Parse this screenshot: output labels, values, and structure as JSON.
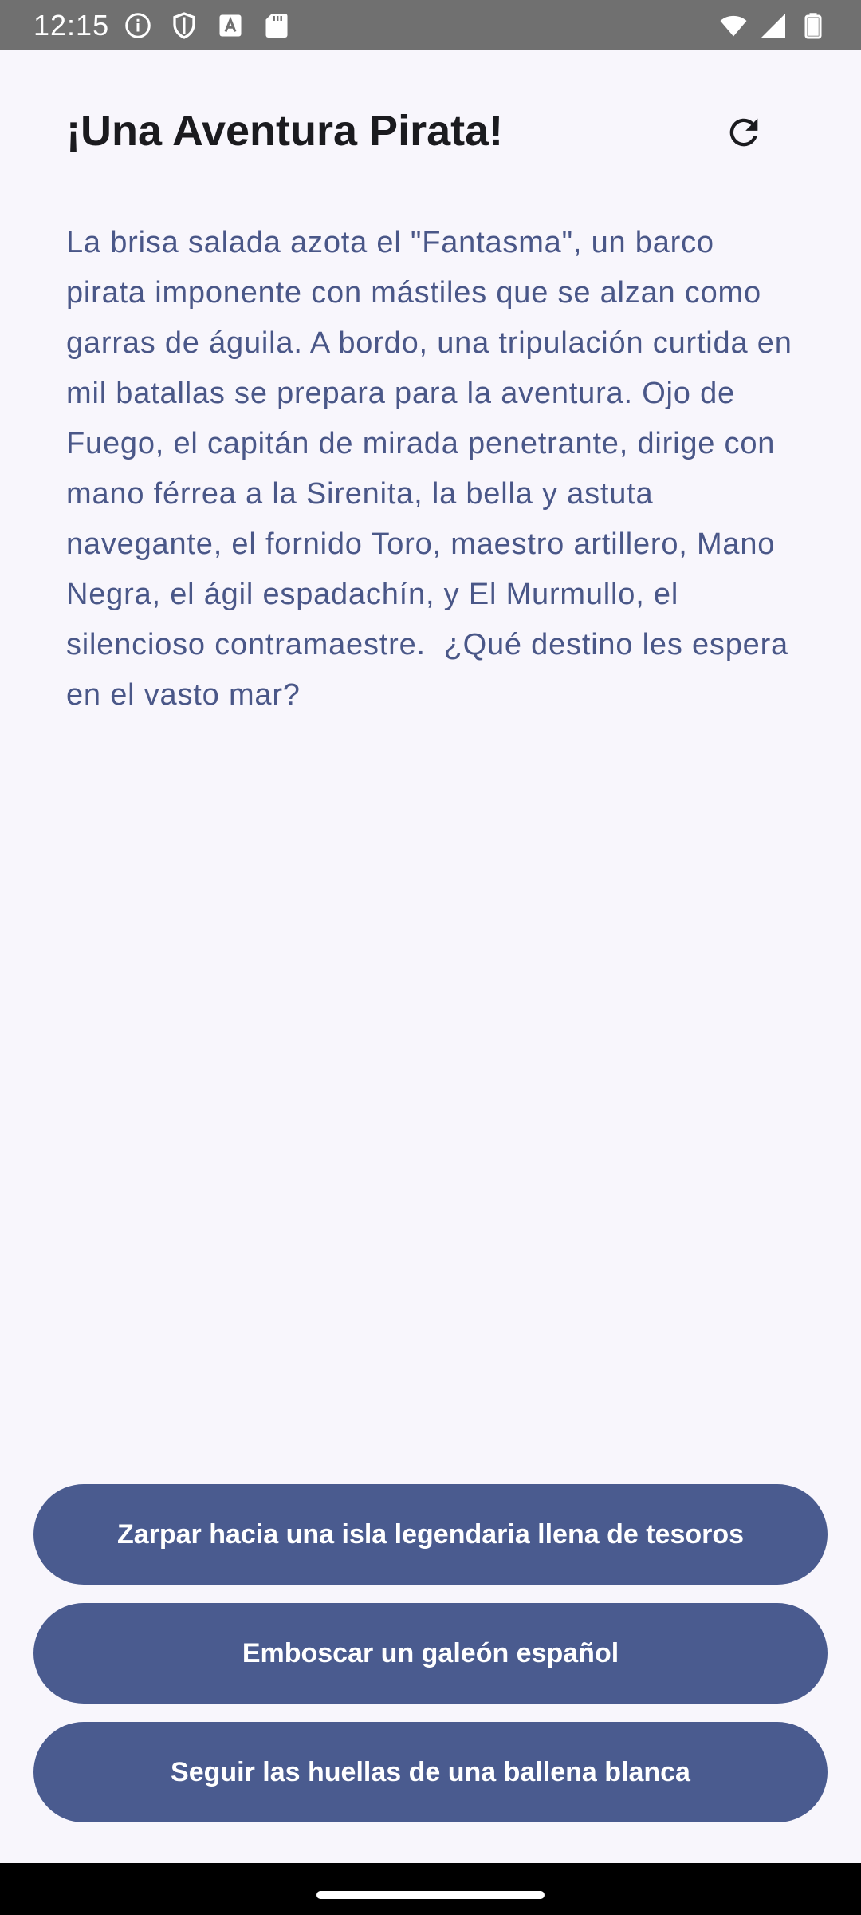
{
  "status_bar": {
    "time": "12:15",
    "left_icons": [
      "info-icon",
      "shield-icon",
      "font-icon",
      "sd-card-icon"
    ],
    "right_icons": [
      "wifi-icon",
      "signal-icon",
      "battery-icon"
    ]
  },
  "header": {
    "title": "¡Una Aventura Pirata!",
    "refresh_icon": "refresh-icon"
  },
  "story": {
    "text": "La brisa salada azota el \"Fantasma\", un barco pirata imponente con mástiles que se alzan como garras de águila. A bordo, una tripulación curtida en mil batallas se prepara para la aventura. Ojo de Fuego, el capitán de mirada penetrante, dirige con mano férrea a la Sirenita, la bella y astuta navegante, el fornido Toro, maestro artillero, Mano Negra, el ágil espadachín, y El Murmullo, el silencioso contramaestre.  ¿Qué destino les espera en el vasto mar?"
  },
  "choices": [
    {
      "label": "Zarpar hacia una isla legendaria llena de tesoros"
    },
    {
      "label": "Emboscar un galeón español"
    },
    {
      "label": "Seguir las huellas de una ballena blanca"
    }
  ],
  "colors": {
    "background": "#f8f6fc",
    "accent": "#4a5b8f",
    "story_text": "#4a5788",
    "status_bar": "#707070"
  }
}
